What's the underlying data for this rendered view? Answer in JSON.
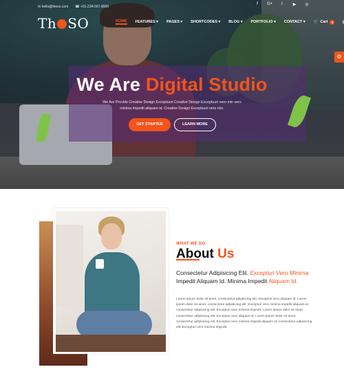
{
  "topbar": {
    "email": "✉ hello@theso.com",
    "phone": "☎ +01-234-567-8900"
  },
  "socials": [
    {
      "icon": "facebook-icon",
      "glyph": "f"
    },
    {
      "icon": "google-plus-icon",
      "glyph": "G+"
    },
    {
      "icon": "twitter-icon",
      "glyph": "t"
    },
    {
      "icon": "youtube-icon",
      "glyph": "▶"
    },
    {
      "icon": "instagram-icon",
      "glyph": "◎"
    }
  ],
  "logo": {
    "left": "Th",
    "right": "SO"
  },
  "nav": {
    "items": [
      "HOME",
      "FEATURES ▾",
      "PAGES ▾",
      "SHORTCODES ▾",
      "BLOG ▾",
      "PORTFOLIO ▾",
      "CONTACT ▾"
    ],
    "cart_label": "Cart",
    "cart_count": "2"
  },
  "side_tab": "⚙",
  "hero": {
    "title_white": "We Are",
    "title_accent": "Digital Studio",
    "subtitle": "We Are Provide Creative Design Exceptuuri Creative Design Exceptuuri vero min vero minima impedit aliquam id. Creative Design Exceptuuri vero min.",
    "btn_primary": "GET STARTED",
    "btn_secondary": "LEARN MORE"
  },
  "about": {
    "kicker": "WHAT WE DO",
    "title_dark": "About",
    "title_accent": "Us",
    "lead_1": "Consectetur Adipisicing Elit.",
    "lead_2": "Excepturi Vero Minima",
    "lead_3": "Impedit Aliquam Id. Minima Impedit",
    "lead_4": "Aliquam Id.",
    "body": "Lorem Ipsum dolor sit amet, consectetur adipisicing elit. Excepturi vero aliquam id. Lorem ipsum dolor sit amet, consectetur adipisicing elit. Excepturi vero minima impedit aliquam id, consectetur adipisicing elit. Excepturi vero minima impedit. Lorem Ipsum dolor sit amet, consectetur adipisicing elit. Excepturi vero aliquam id. Lorem ipsum dolor sit amet, consectetur adipisicing elit. Excepturi vero minima impedit aliquam id, consectetur adipisicing elit. Excepturi vero minima impedit."
  },
  "colors": {
    "accent": "#f2541b",
    "overlay": "#582c78"
  }
}
